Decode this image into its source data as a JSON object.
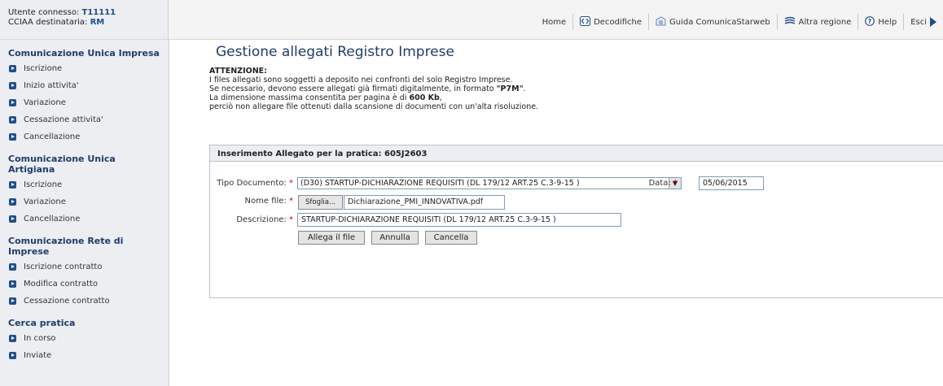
{
  "header": {
    "user_label": "Utente connesso:",
    "user_value": "T11111",
    "cciaa_label": "CCIAA destinataria:",
    "cciaa_value": "RM",
    "nav": [
      {
        "label": "Home",
        "icon": "home-link"
      },
      {
        "label": "Decodifiche",
        "icon": "decode-icon"
      },
      {
        "label": "Guida ComunicaStarweb",
        "icon": "guide-icon"
      },
      {
        "label": "Altra regione",
        "icon": "region-icon"
      },
      {
        "label": "Help",
        "icon": "help-icon"
      },
      {
        "label": "Esci",
        "icon": "exit-icon"
      }
    ]
  },
  "sidebar": {
    "sections": [
      {
        "title": "Comunicazione Unica Impresa",
        "items": [
          "Iscrizione",
          "Inizio attivita'",
          "Variazione",
          "Cessazione attivita'",
          "Cancellazione"
        ]
      },
      {
        "title": "Comunicazione Unica Artigiana",
        "items": [
          "Iscrizione",
          "Variazione",
          "Cancellazione"
        ]
      },
      {
        "title": "Comunicazione Rete di Imprese",
        "items": [
          "Iscrizione contratto",
          "Modifica contratto",
          "Cessazione contratto"
        ]
      },
      {
        "title": "Cerca pratica",
        "items": [
          "In corso",
          "Inviate"
        ]
      }
    ]
  },
  "main": {
    "title": "Gestione allegati Registro Imprese",
    "notice": {
      "heading": "ATTENZIONE:",
      "line1": "I files allegati sono soggetti a deposito nei confronti del solo Registro Imprese.",
      "line2_pre": "Se necessario, devono essere allegati già firmati digitalmente, in formato ",
      "line2_bold": "\"P7M\"",
      "line2_post": ".",
      "line3_pre": "La dimensione massima consentita per pagina è di ",
      "line3_bold": "600 Kb",
      "line3_post": ",",
      "line4": "perciò non allegare file ottenuti dalla scansione di documenti con un'alta risoluzione."
    },
    "panel": {
      "heading": "Inserimento Allegato per la pratica: 605J2603",
      "tipo_label": "Tipo Documento:",
      "tipo_value": "(D30) STARTUP-DICHIARAZIONE REQUISITI (DL 179/12 ART.25 C.3-9-15 )",
      "data_label": "Data:",
      "data_value": "05/06/2015",
      "nome_label": "Nome file:",
      "browse_label": "Sfoglia...",
      "file_value": "Dichiarazione_PMI_INNOVATIVA.pdf",
      "descr_label": "Descrizione:",
      "descr_value": "STARTUP-DICHIARAZIONE REQUISITI (DL 179/12 ART.25 C.3-9-15 )",
      "required_mark": "*",
      "buttons": {
        "attach": "Allega il file",
        "cancel": "Annulla",
        "delete": "Cancella"
      }
    }
  },
  "colors": {
    "accent": "#1f4e8c",
    "title": "#1f3d6b",
    "required": "#cc0000"
  }
}
